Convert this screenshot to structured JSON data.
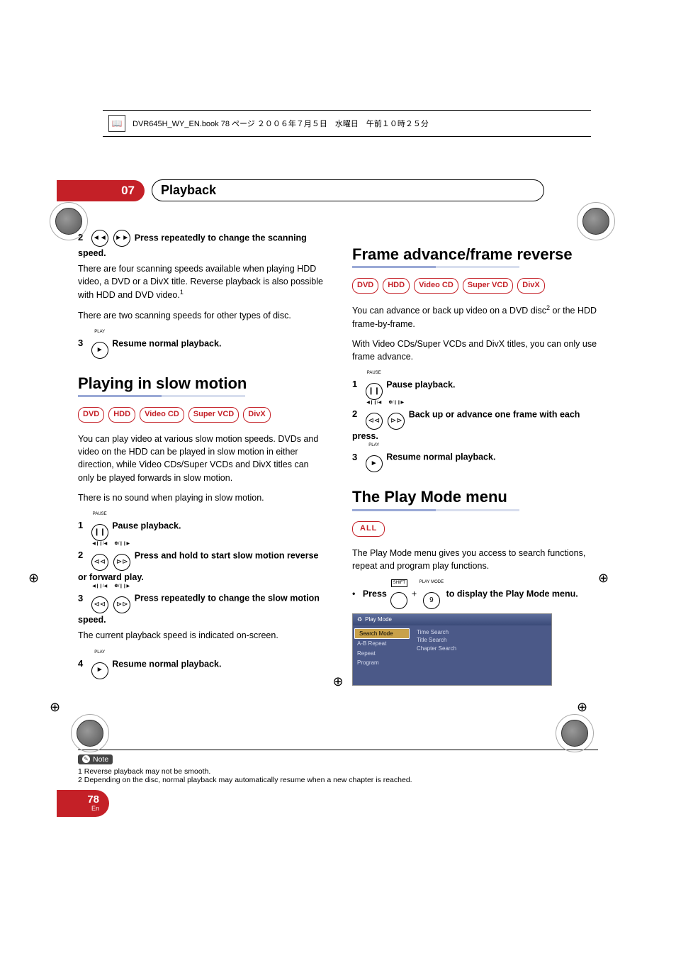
{
  "header_strip": "DVR645H_WY_EN.book 78 ページ ２００６年７月５日　水曜日　午前１０時２５分",
  "chapter": {
    "num": "07",
    "title": "Playback"
  },
  "col1": {
    "step2": {
      "num": "2",
      "bold": "Press repeatedly to change the scanning speed."
    },
    "p1": "There are four scanning speeds available when playing HDD video, a DVD or a DivX title. Reverse playback is also possible with HDD and DVD video.",
    "sup1": "1",
    "p2": "There are two scanning speeds for other types of disc.",
    "step3": {
      "num": "3",
      "lbl": "PLAY",
      "glyph": "►",
      "bold": "Resume normal playback."
    },
    "h2a": "Playing in slow motion",
    "tags1": [
      "DVD",
      "HDD",
      "Video CD",
      "Super VCD",
      "DivX"
    ],
    "p3": "You can play video at various slow motion speeds. DVDs and video on the HDD can be played in slow motion in either direction, while Video CDs/Super VCDs and DivX titles can only be played forwards in slow motion.",
    "p4": "There is no sound when playing in slow motion.",
    "s1": {
      "num": "1",
      "lbl": "PAUSE",
      "glyph": "❙❙",
      "bold": "Pause playback."
    },
    "s2": {
      "num": "2",
      "l1": "◀❙❙/◀",
      "l2": "❿/❙❙▶",
      "g1": "⊲⊲",
      "g2": "⊳⊳",
      "bold": "Press and hold to start slow motion reverse or forward play."
    },
    "s3": {
      "num": "3",
      "l1": "◀❙❙/◀",
      "l2": "❿/❙❙▶",
      "g1": "⊲⊲",
      "g2": "⊳⊳",
      "bold": "Press repeatedly to change the slow motion speed."
    },
    "p5": "The current playback speed is indicated on-screen.",
    "s4": {
      "num": "4",
      "lbl": "PLAY",
      "glyph": "►",
      "bold": "Resume normal playback."
    }
  },
  "col2": {
    "h2a": "Frame advance/frame reverse",
    "tags1": [
      "DVD",
      "HDD",
      "Video CD",
      "Super VCD",
      "DivX"
    ],
    "p1a": "You can advance or back up video on a DVD disc",
    "sup2": "2",
    "p1b": " or the HDD frame-by-frame.",
    "p2": "With Video CDs/Super VCDs and DivX titles, you can only use frame advance.",
    "s1": {
      "num": "1",
      "lbl": "PAUSE",
      "glyph": "❙❙",
      "bold": "Pause playback."
    },
    "s2": {
      "num": "2",
      "l1": "◀❙❙/◀",
      "l2": "❿/❙❙▶",
      "g1": "⊲⊲",
      "g2": "⊳⊳",
      "bold": "Back up or advance one frame with each press."
    },
    "s3": {
      "num": "3",
      "lbl": "PLAY",
      "glyph": "►",
      "bold": "Resume normal playback."
    },
    "h2b": "The Play Mode menu",
    "tag_all": "ALL",
    "p3": "The Play Mode menu gives you access to search functions, repeat and program play functions.",
    "bullet": {
      "pre": "•",
      "press": "Press",
      "shift": "SHIFT",
      "plus": "+",
      "pmlbl": "PLAY MODE",
      "nine": "9",
      "bold": "to display the Play Mode menu."
    },
    "pm": {
      "title": "Play Mode",
      "left": [
        "Search Mode",
        "A-B Repeat",
        "Repeat",
        "Program"
      ],
      "right": [
        "Time Search",
        "Title Search",
        "Chapter Search"
      ]
    }
  },
  "notes": {
    "label": "Note",
    "n1": "1 Reverse playback may not be smooth.",
    "n2": "2 Depending on the disc, normal playback may automatically resume when a new chapter is reached."
  },
  "page": {
    "num": "78",
    "lang": "En"
  }
}
